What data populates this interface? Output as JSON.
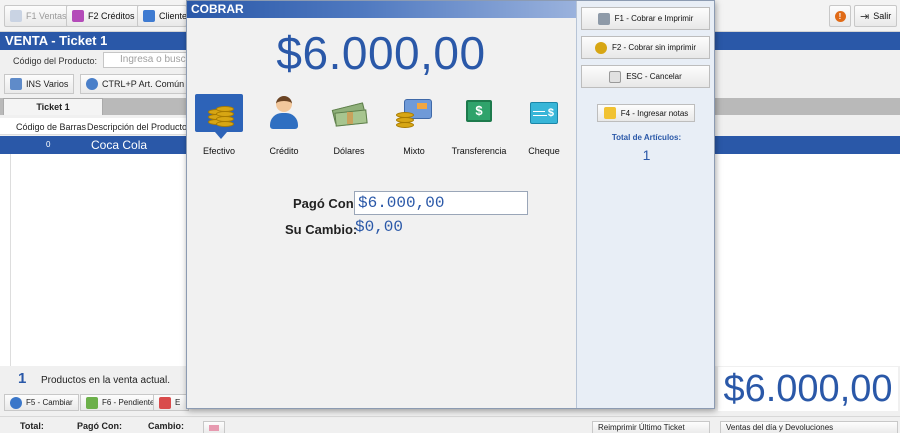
{
  "topbar": {
    "ventas": "F1 Ventas",
    "creditos": "F2 Créditos",
    "clientes": "Clientes",
    "salir": "Salir"
  },
  "venta": {
    "title": "VENTA - Ticket 1",
    "codigo_label": "Código del Producto:",
    "codigo_placeholder": "Ingresa o busca",
    "ins_varios": "INS Varios",
    "art_comun": "CTRL+P Art. Común"
  },
  "tabs": {
    "ticket": "Ticket 1"
  },
  "grid": {
    "columns": [
      "Código de Barras",
      "Descripción del Producto"
    ],
    "rows": [
      {
        "codigo": "0",
        "descripcion": "Coca Cola"
      }
    ]
  },
  "footer": {
    "count": "1",
    "count_text": "Productos en la venta actual.",
    "f5": "F5 - Cambiar",
    "f6": "F6 - Pendiente",
    "third_btn": "E",
    "total_amount": "$6.000,00"
  },
  "statusbar": {
    "total": "Total:",
    "pago": "Pagó Con:",
    "cambio": "Cambio:",
    "reimprimir": "Reimprimir Último Ticket",
    "ventas_dia": "Ventas del día y Devoluciones"
  },
  "dialog": {
    "title": "COBRAR",
    "amount": "$6.000,00",
    "methods": [
      {
        "label": "Efectivo",
        "icon": "coins-icon",
        "selected": true
      },
      {
        "label": "Crédito",
        "icon": "person-icon"
      },
      {
        "label": "Dólares",
        "icon": "dollar-bills-icon"
      },
      {
        "label": "Mixto",
        "icon": "card-and-coins-icon"
      },
      {
        "label": "Transferencia",
        "icon": "bank-note-icon"
      },
      {
        "label": "Cheque",
        "icon": "cheque-icon"
      }
    ],
    "pago_label": "Pagó Con:",
    "pago_value": "$6.000,00",
    "cambio_label": "Su Cambio:",
    "cambio_value": "$0,00",
    "side": {
      "f1": "F1 - Cobrar e Imprimir",
      "f2": "F2 - Cobrar sin imprimir",
      "esc": "ESC - Cancelar",
      "f4": "F4 - Ingresar notas",
      "total_articulos_label": "Total de Artículos:",
      "total_articulos_value": "1"
    }
  },
  "colors": {
    "accent": "#2a58a8",
    "coin": "#d7a614",
    "note": "#2fa36b"
  }
}
